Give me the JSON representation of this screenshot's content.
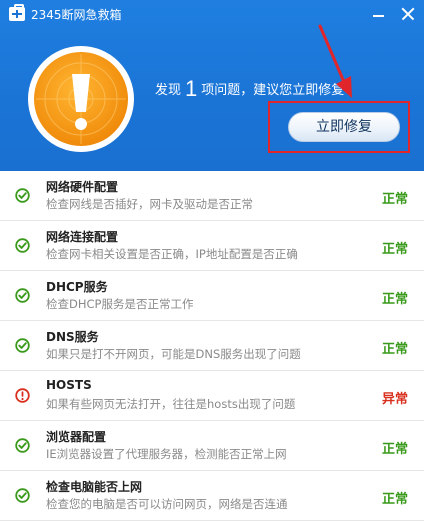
{
  "window": {
    "title": "2345断网急救箱",
    "icons": {
      "logo": "first-aid-kit-icon",
      "minimize": "minimize-icon",
      "close": "close-icon"
    }
  },
  "summary": {
    "prefix": "发现",
    "count": "1",
    "suffix": "项问题，建议您立即修复"
  },
  "fix_button": {
    "label": "立即修复"
  },
  "colors": {
    "header_blue": "#1a74d6",
    "ok_green": "#3a9a1c",
    "error_red": "#d9301e",
    "alert_orange": "#f59b12",
    "highlight_red": "#e0262a"
  },
  "checks": [
    {
      "title": "网络硬件配置",
      "desc": "检查网线是否插好，网卡及驱动是否正常",
      "status": "正常",
      "ok": true
    },
    {
      "title": "网络连接配置",
      "desc": "检查网卡相关设置是否正确，IP地址配置是否正确",
      "status": "正常",
      "ok": true
    },
    {
      "title": "DHCP服务",
      "desc": "检查DHCP服务是否正常工作",
      "status": "正常",
      "ok": true
    },
    {
      "title": "DNS服务",
      "desc": "如果只是打不开网页，可能是DNS服务出现了问题",
      "status": "正常",
      "ok": true
    },
    {
      "title": "HOSTS",
      "desc": "如果有些网页无法打开，往往是hosts出现了问题",
      "status": "异常",
      "ok": false
    },
    {
      "title": "浏览器配置",
      "desc": "IE浏览器设置了代理服务器，检测能否正常上网",
      "status": "正常",
      "ok": true
    },
    {
      "title": "检查电脑能否上网",
      "desc": "检查您的电脑是否可以访问网页，网络是否连通",
      "status": "正常",
      "ok": true
    }
  ]
}
